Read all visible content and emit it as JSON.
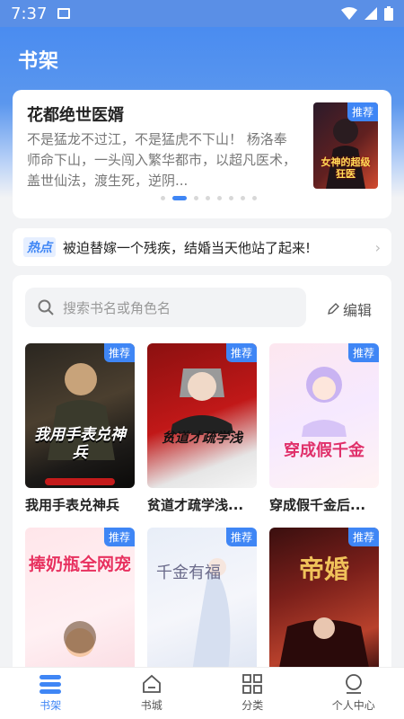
{
  "status": {
    "time": "7:37"
  },
  "header": {
    "title": "书架"
  },
  "featured": {
    "title": "花都绝世医婿",
    "description": "不是猛龙不过江，不是猛虎不下山！ 杨洛奉师命下山，一头闯入繁华都市，以超凡医术，盖世仙法，渡生死，逆阴...",
    "badge": "推荐",
    "cover_text": "女神的超级狂医",
    "dots": 8,
    "active_dot": 1
  },
  "hot": {
    "tag": "热点",
    "text": "被迫替嫁一个残疾，结婚当天他站了起来!"
  },
  "shelf": {
    "search_placeholder": "搜索书名或角色名",
    "edit_label": "编辑",
    "books": [
      {
        "name": "我用手表兑神兵",
        "badge": "推荐",
        "cover_text": "我用手表兑神兵"
      },
      {
        "name": "贫道才疏学浅...",
        "badge": "推荐",
        "cover_text": "贫道才疏学浅"
      },
      {
        "name": "穿成假千金后...",
        "badge": "推荐",
        "cover_text": "穿成假千金"
      },
      {
        "name": "",
        "badge": "推荐",
        "cover_text": "捧奶瓶全网宠"
      },
      {
        "name": "",
        "badge": "推荐",
        "cover_text": "千金有福"
      },
      {
        "name": "",
        "badge": "推荐",
        "cover_text": "帝婚"
      }
    ]
  },
  "nav": {
    "items": [
      {
        "label": "书架",
        "icon": "bookshelf-icon",
        "active": true
      },
      {
        "label": "书城",
        "icon": "store-icon",
        "active": false
      },
      {
        "label": "分类",
        "icon": "grid-icon",
        "active": false
      },
      {
        "label": "个人中心",
        "icon": "user-icon",
        "active": false
      }
    ]
  },
  "colors": {
    "accent": "#3f86f5",
    "header": "#4a8cf0"
  }
}
